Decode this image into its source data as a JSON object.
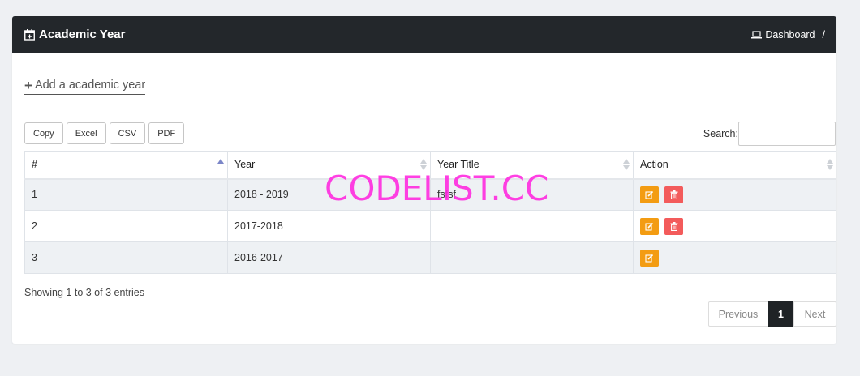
{
  "header": {
    "title": "Academic Year",
    "breadcrumb": "Dashboard",
    "breadcrumb_sep": "/"
  },
  "add_link": {
    "plus": "+",
    "label": "Add a academic year"
  },
  "export_buttons": [
    "Copy",
    "Excel",
    "CSV",
    "PDF"
  ],
  "search": {
    "label": "Search:",
    "value": ""
  },
  "table": {
    "columns": [
      "#",
      "Year",
      "Year Title",
      "Action"
    ],
    "rows": [
      {
        "num": "1",
        "year": "2018 - 2019",
        "title": "fsfsf",
        "edit": true,
        "delete": true
      },
      {
        "num": "2",
        "year": "2017-2018",
        "title": "",
        "edit": true,
        "delete": true
      },
      {
        "num": "3",
        "year": "2016-2017",
        "title": "",
        "edit": true,
        "delete": false
      }
    ]
  },
  "info": "Showing 1 to 3 of 3 entries",
  "pagination": {
    "previous": "Previous",
    "current": "1",
    "next": "Next"
  },
  "watermark": "CODELIST.CC",
  "colors": {
    "header_bg": "#23272b",
    "edit_button": "#f39c12",
    "delete_button": "#f35b5b",
    "active_page": "#1f2326",
    "watermark": "#ff2be0"
  }
}
